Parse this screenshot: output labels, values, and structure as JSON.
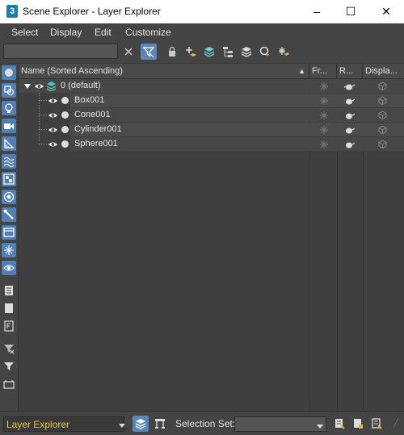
{
  "window": {
    "title": "Scene Explorer - Layer Explorer",
    "app_icon_glyph": "3",
    "minimize": "–",
    "maximize": "☐",
    "close": "✕"
  },
  "menu": [
    "Select",
    "Display",
    "Edit",
    "Customize"
  ],
  "search": {
    "value": "",
    "placeholder": ""
  },
  "toolbar_icons": [
    "clear-search-icon",
    "filter-icon",
    "lock-icon",
    "add-layer-icon",
    "layers-icon",
    "hierarchy-icon",
    "layer-stack-icon",
    "move-to-layer-icon",
    "freeze-layer-icon"
  ],
  "left_toolbar_icons": [
    "geometry-icon",
    "shapes-icon",
    "lights-icon",
    "cameras-icon",
    "helpers-icon",
    "spacewarps-icon",
    "groups-icon",
    "xrefs-icon",
    "bones-icon",
    "containers-icon",
    "frozen-icon",
    "hidden-icon",
    "select-all-icon",
    "select-none-icon",
    "select-invert-icon",
    "filter-toggle-icon",
    "filter-icon",
    "advanced-filter-icon"
  ],
  "columns": {
    "name": "Name (Sorted Ascending)",
    "sort_arrow": "▲",
    "frozen": "Fr...",
    "render": "R...",
    "display": "Displa..."
  },
  "layers": [
    {
      "name": "0 (default)",
      "expanded": true,
      "children": [
        {
          "name": "Box001"
        },
        {
          "name": "Cone001"
        },
        {
          "name": "Cylinder001"
        },
        {
          "name": "Sphere001"
        }
      ]
    }
  ],
  "bottom": {
    "explorer_name": "Layer Explorer",
    "selection_set_label": "Selection Set:",
    "selection_set_value": ""
  },
  "colors": {
    "accent": "#5a86b8",
    "explorer_text": "#e8c34a",
    "panel_bg": "#3f3f3f"
  }
}
